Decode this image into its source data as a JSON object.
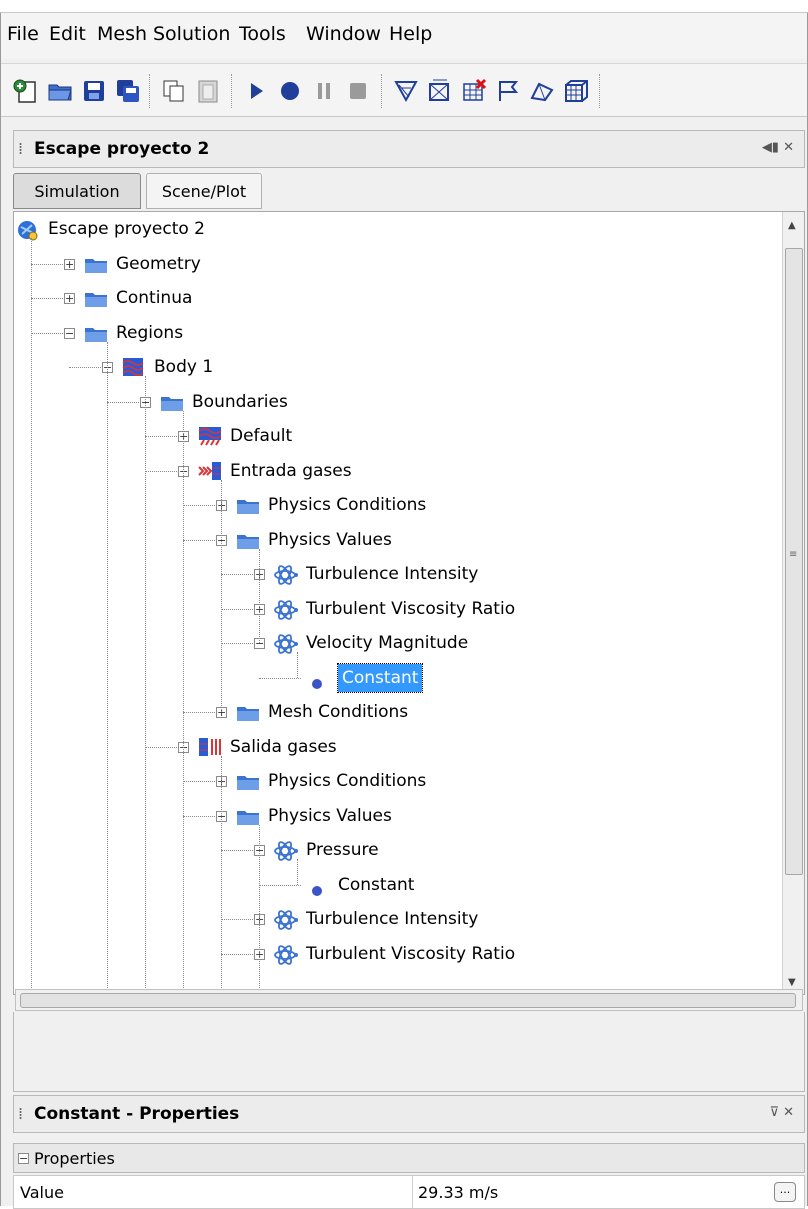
{
  "menu": [
    "File",
    "Edit",
    "Mesh",
    "Solution",
    "Tools",
    "Window",
    "Help"
  ],
  "toolbar_icons": [
    "new-sim-icon",
    "open-icon",
    "save-icon",
    "save-all-icon",
    "copy-icon",
    "clipboard-icon",
    "run-icon",
    "record-icon",
    "pause-icon",
    "stop-icon",
    "mesh-icon",
    "generate-mesh-icon",
    "clear-mesh-icon",
    "flag-icon",
    "surface-icon",
    "volume-icon"
  ],
  "tree_panel": {
    "title": "Escape proyecto 2",
    "tabs": [
      "Simulation",
      "Scene/Plot"
    ],
    "active_tab": "Simulation"
  },
  "tree": [
    {
      "label": "Escape proyecto 2",
      "depth": 0,
      "icon": "simulation-root-icon",
      "expander": "none"
    },
    {
      "label": "Geometry",
      "depth": 1,
      "icon": "folder-icon",
      "expander": "plus"
    },
    {
      "label": "Continua",
      "depth": 1,
      "icon": "folder-icon",
      "expander": "plus"
    },
    {
      "label": "Regions",
      "depth": 1,
      "icon": "folder-icon",
      "expander": "minus"
    },
    {
      "label": "Body 1",
      "depth": 2,
      "icon": "region-icon",
      "expander": "minus"
    },
    {
      "label": "Boundaries",
      "depth": 3,
      "icon": "folder-icon",
      "expander": "minus"
    },
    {
      "label": "Default",
      "depth": 4,
      "icon": "wall-boundary-icon",
      "expander": "plus"
    },
    {
      "label": "Entrada gases",
      "depth": 4,
      "icon": "inlet-boundary-icon",
      "expander": "minus"
    },
    {
      "label": "Physics Conditions",
      "depth": 5,
      "icon": "folder-icon",
      "expander": "plus"
    },
    {
      "label": "Physics Values",
      "depth": 5,
      "icon": "folder-icon",
      "expander": "minus"
    },
    {
      "label": "Turbulence Intensity",
      "depth": 6,
      "icon": "physics-value-icon",
      "expander": "plus"
    },
    {
      "label": "Turbulent Viscosity Ratio",
      "depth": 6,
      "icon": "physics-value-icon",
      "expander": "plus"
    },
    {
      "label": "Velocity Magnitude",
      "depth": 6,
      "icon": "physics-value-icon",
      "expander": "minus"
    },
    {
      "label": "Constant",
      "depth": 7,
      "icon": "dot-icon",
      "expander": "none",
      "selected": true
    },
    {
      "label": "Mesh Conditions",
      "depth": 5,
      "icon": "folder-icon",
      "expander": "plus"
    },
    {
      "label": "Salida gases",
      "depth": 4,
      "icon": "outlet-boundary-icon",
      "expander": "minus"
    },
    {
      "label": "Physics Conditions",
      "depth": 5,
      "icon": "folder-icon",
      "expander": "plus"
    },
    {
      "label": "Physics Values",
      "depth": 5,
      "icon": "folder-icon",
      "expander": "minus"
    },
    {
      "label": "Pressure",
      "depth": 6,
      "icon": "physics-value-icon",
      "expander": "minus"
    },
    {
      "label": "Constant",
      "depth": 7,
      "icon": "dot-icon",
      "expander": "none"
    },
    {
      "label": "Turbulence Intensity",
      "depth": 6,
      "icon": "physics-value-icon",
      "expander": "plus"
    },
    {
      "label": "Turbulent Viscosity Ratio",
      "depth": 6,
      "icon": "physics-value-icon",
      "expander": "plus"
    }
  ],
  "properties_panel": {
    "title": "Constant - Properties",
    "group_label": "Properties",
    "rows": [
      {
        "name": "Value",
        "value": "29.33 m/s"
      }
    ],
    "ellipsis": "..."
  },
  "colors": {
    "selection_bg": "#3399ff",
    "folder_blue": "#4f86d6",
    "region_blue": "#2a5bd7"
  }
}
